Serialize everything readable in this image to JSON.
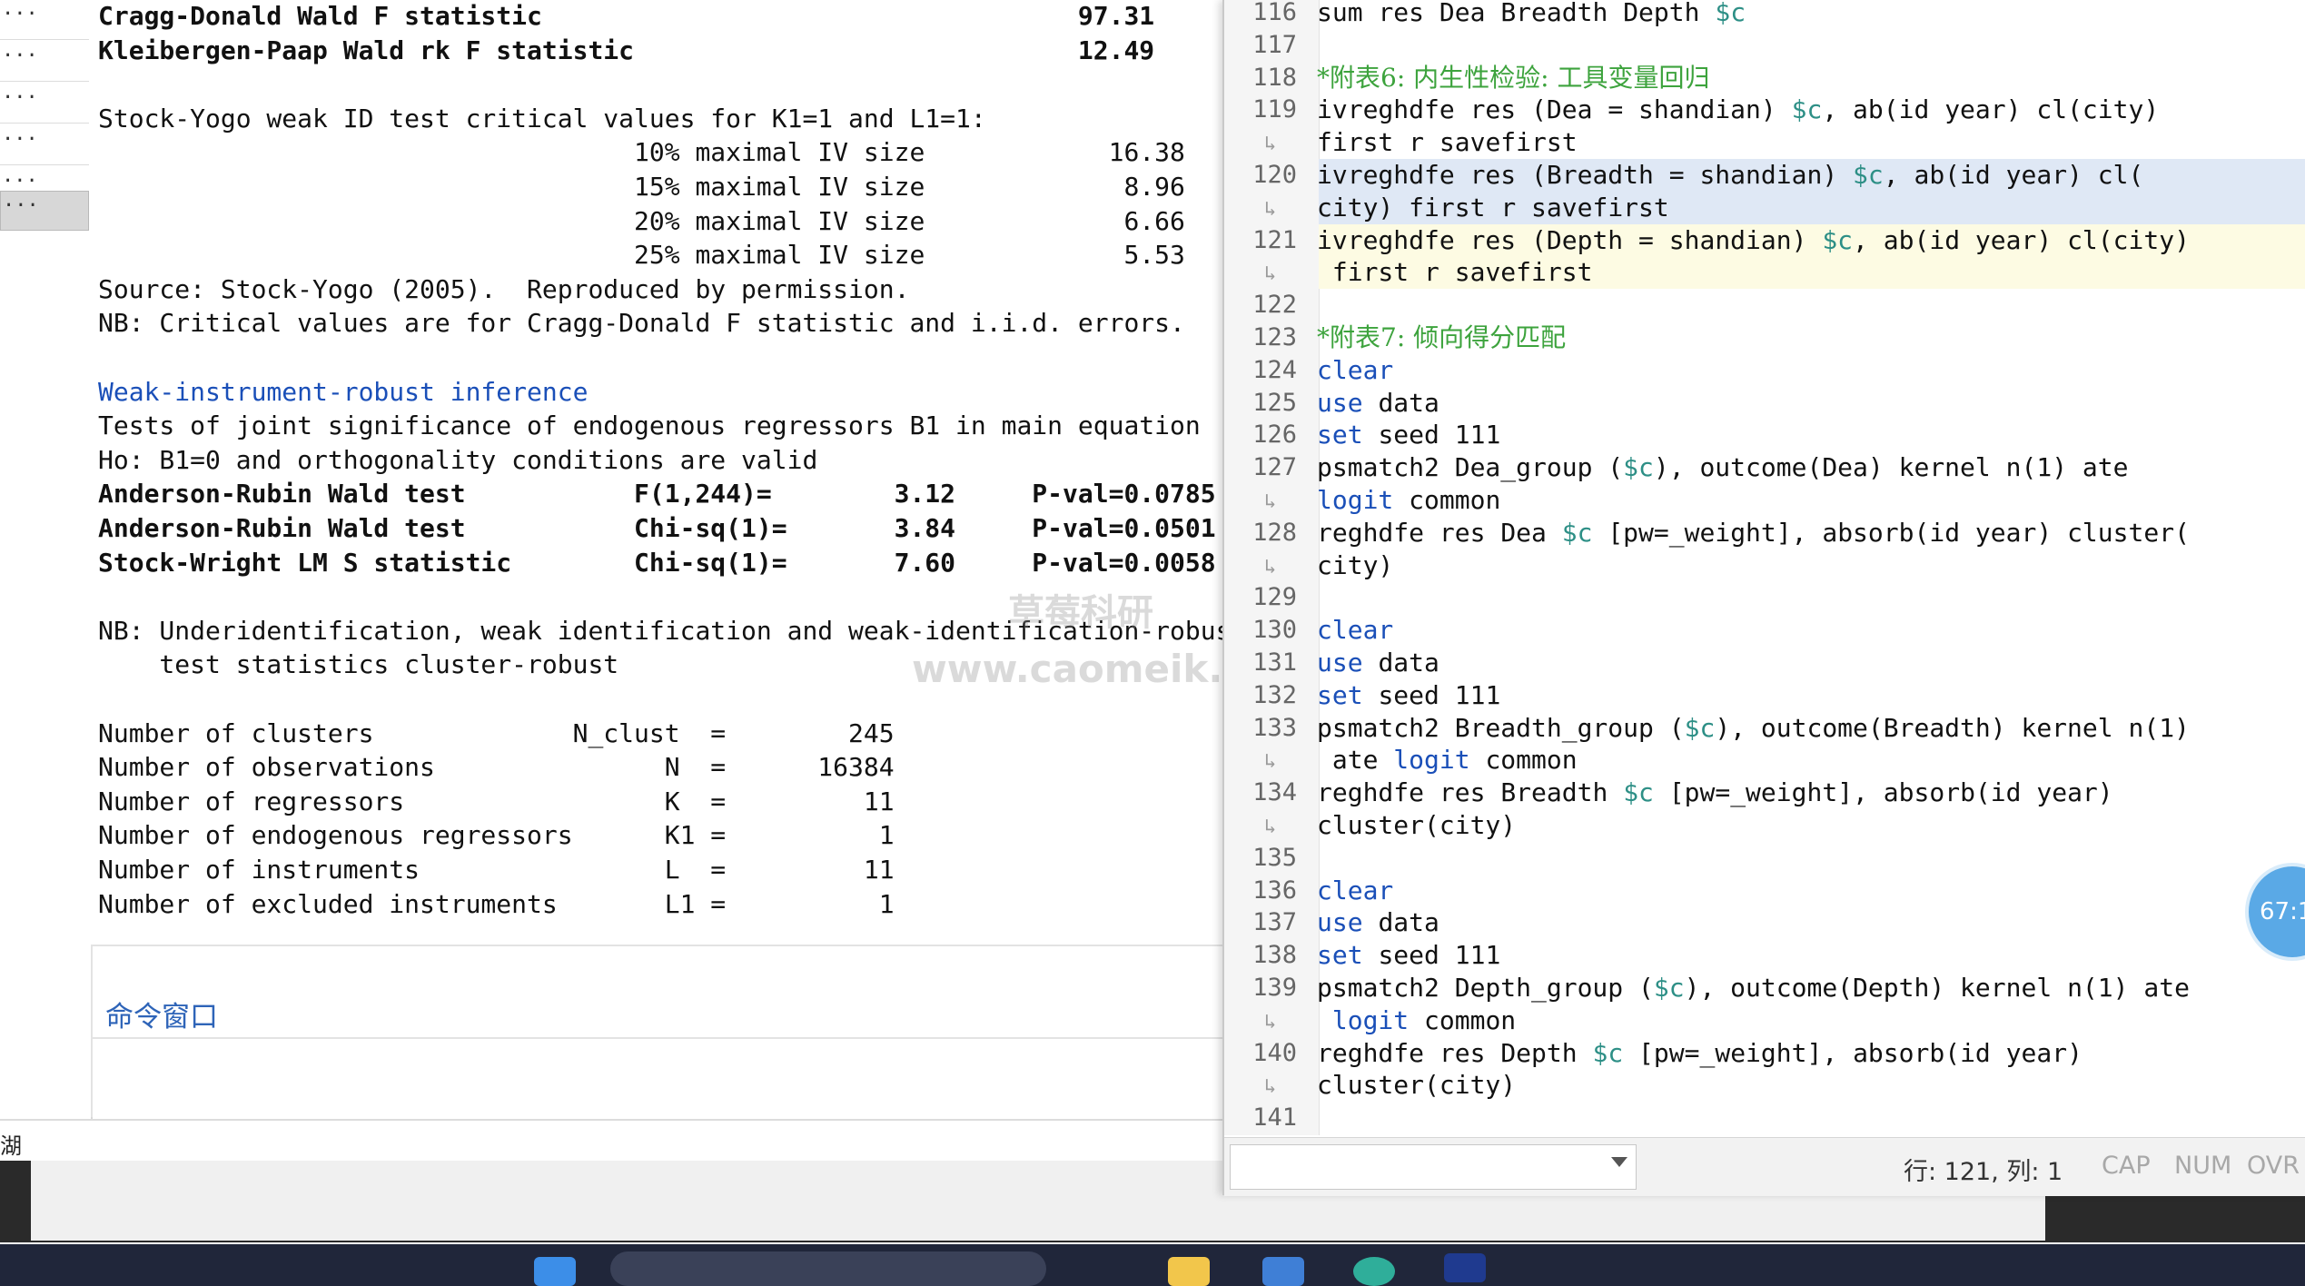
{
  "history": [
    "...",
    "...",
    "...",
    "...",
    "...",
    "..."
  ],
  "results": {
    "lines": [
      {
        "text": "Cragg-Donald Wald F statistic                                   97.31",
        "style": "b"
      },
      {
        "text": "Kleibergen-Paap Wald rk F statistic                             12.49",
        "style": "b"
      },
      {
        "text": "",
        "style": ""
      },
      {
        "text": "Stock-Yogo weak ID test critical values for K1=1 and L1=1:",
        "style": ""
      },
      {
        "text": "                                   10% maximal IV size            16.38",
        "style": ""
      },
      {
        "text": "                                   15% maximal IV size             8.96",
        "style": ""
      },
      {
        "text": "                                   20% maximal IV size             6.66",
        "style": ""
      },
      {
        "text": "                                   25% maximal IV size             5.53",
        "style": ""
      },
      {
        "text": "Source: Stock-Yogo (2005).  Reproduced by permission.",
        "style": ""
      },
      {
        "text": "NB: Critical values are for Cragg-Donald F statistic and i.i.d. errors.",
        "style": ""
      },
      {
        "text": "",
        "style": ""
      },
      {
        "text": "Weak-instrument-robust inference",
        "style": "blue"
      },
      {
        "text": "Tests of joint significance of endogenous regressors B1 in main equation",
        "style": ""
      },
      {
        "text": "Ho: B1=0 and orthogonality conditions are valid",
        "style": ""
      },
      {
        "text": "Anderson-Rubin Wald test           F(1,244)=        3.12     P-val=0.0785",
        "style": "b"
      },
      {
        "text": "Anderson-Rubin Wald test           Chi-sq(1)=       3.84     P-val=0.0501",
        "style": "b"
      },
      {
        "text": "Stock-Wright LM S statistic        Chi-sq(1)=       7.60     P-val=0.0058",
        "style": "b"
      },
      {
        "text": "",
        "style": ""
      },
      {
        "text": "NB: Underidentification, weak identification and weak-identification-robust",
        "style": ""
      },
      {
        "text": "    test statistics cluster-robust",
        "style": ""
      },
      {
        "text": "",
        "style": ""
      },
      {
        "text": "Number of clusters             N_clust  =        245",
        "style": "stat"
      },
      {
        "text": "Number of observations               N  =      16384",
        "style": "stat"
      },
      {
        "text": "Number of regressors                 K  =         11",
        "style": "stat"
      },
      {
        "text": "Number of endogenous regressors      K1 =          1",
        "style": "stat"
      },
      {
        "text": "Number of instruments                L  =         11",
        "style": "stat"
      },
      {
        "text": "Number of excluded instruments       L1 =          1",
        "style": "stat"
      }
    ]
  },
  "command_window_label": "命令窗口",
  "statusbar_left": "湖",
  "watermark": {
    "line1": "草莓科研",
    "line2": "www.caomeik...com"
  },
  "editor": {
    "rows": [
      {
        "ln": "116",
        "wrap": false,
        "text": "sum res Dea Breadth Depth $c",
        "hl": ""
      },
      {
        "ln": "117",
        "wrap": false,
        "text": "",
        "hl": ""
      },
      {
        "ln": "118",
        "wrap": false,
        "text": "*附表6: 内生性检验: 工具变量回归",
        "hl": ""
      },
      {
        "ln": "119",
        "wrap": false,
        "text": "ivreghdfe res (Dea = shandian) $c, ab(id year) cl(city)",
        "hl": ""
      },
      {
        "ln": "",
        "wrap": true,
        "text": "first r savefirst",
        "hl": ""
      },
      {
        "ln": "120",
        "wrap": false,
        "text": "ivreghdfe res (Breadth = shandian) $c, ab(id year) cl(",
        "hl": "sel"
      },
      {
        "ln": "",
        "wrap": true,
        "text": "city) first r savefirst",
        "hl": "sel"
      },
      {
        "ln": "121",
        "wrap": false,
        "text": "ivreghdfe res (Depth = shandian) $c, ab(id year) cl(city)",
        "hl": "cur"
      },
      {
        "ln": "",
        "wrap": true,
        "text": " first r savefirst",
        "hl": "cur"
      },
      {
        "ln": "122",
        "wrap": false,
        "text": "",
        "hl": ""
      },
      {
        "ln": "123",
        "wrap": false,
        "text": "*附表7: 倾向得分匹配",
        "hl": ""
      },
      {
        "ln": "124",
        "wrap": false,
        "text": "clear",
        "hl": ""
      },
      {
        "ln": "125",
        "wrap": false,
        "text": "use data",
        "hl": ""
      },
      {
        "ln": "126",
        "wrap": false,
        "text": "set seed 111",
        "hl": ""
      },
      {
        "ln": "127",
        "wrap": false,
        "text": "psmatch2 Dea_group ($c), outcome(Dea) kernel n(1) ate",
        "hl": ""
      },
      {
        "ln": "",
        "wrap": true,
        "text": "logit common",
        "hl": ""
      },
      {
        "ln": "128",
        "wrap": false,
        "text": "reghdfe res Dea $c [pw=_weight], absorb(id year) cluster(",
        "hl": ""
      },
      {
        "ln": "",
        "wrap": true,
        "text": "city)",
        "hl": ""
      },
      {
        "ln": "129",
        "wrap": false,
        "text": "",
        "hl": ""
      },
      {
        "ln": "130",
        "wrap": false,
        "text": "clear",
        "hl": ""
      },
      {
        "ln": "131",
        "wrap": false,
        "text": "use data",
        "hl": ""
      },
      {
        "ln": "132",
        "wrap": false,
        "text": "set seed 111",
        "hl": ""
      },
      {
        "ln": "133",
        "wrap": false,
        "text": "psmatch2 Breadth_group ($c), outcome(Breadth) kernel n(1)",
        "hl": ""
      },
      {
        "ln": "",
        "wrap": true,
        "text": " ate logit common",
        "hl": ""
      },
      {
        "ln": "134",
        "wrap": false,
        "text": "reghdfe res Breadth $c [pw=_weight], absorb(id year)",
        "hl": ""
      },
      {
        "ln": "",
        "wrap": true,
        "text": "cluster(city)",
        "hl": ""
      },
      {
        "ln": "135",
        "wrap": false,
        "text": "",
        "hl": ""
      },
      {
        "ln": "136",
        "wrap": false,
        "text": "clear",
        "hl": ""
      },
      {
        "ln": "137",
        "wrap": false,
        "text": "use data",
        "hl": ""
      },
      {
        "ln": "138",
        "wrap": false,
        "text": "set seed 111",
        "hl": ""
      },
      {
        "ln": "139",
        "wrap": false,
        "text": "psmatch2 Depth_group ($c), outcome(Depth) kernel n(1) ate",
        "hl": ""
      },
      {
        "ln": "",
        "wrap": true,
        "text": " logit common",
        "hl": ""
      },
      {
        "ln": "140",
        "wrap": false,
        "text": "reghdfe res Depth $c [pw=_weight], absorb(id year)",
        "hl": ""
      },
      {
        "ln": "",
        "wrap": true,
        "text": "cluster(city)",
        "hl": ""
      },
      {
        "ln": "141",
        "wrap": false,
        "text": "",
        "hl": ""
      }
    ],
    "status": {
      "position": "行: 121, 列: 1",
      "cap": "CAP",
      "num": "NUM",
      "ovr": "OVR"
    }
  },
  "floating_badge": "67:1",
  "colors": {
    "keyword": "#1a4fb8",
    "macro": "#2d8f86",
    "comment": "#3da33d",
    "selection": "#dfe8f5",
    "current_line": "#fdfbe3"
  }
}
